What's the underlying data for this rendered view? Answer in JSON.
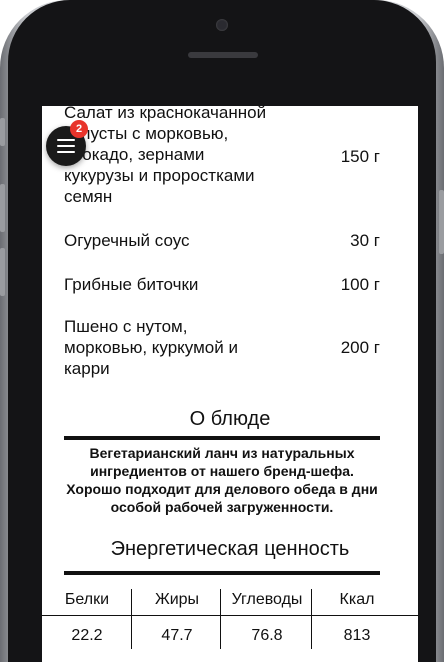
{
  "menu_items": [
    {
      "name": "Салат из краснокачанной капусты с морковью, авокадо, зернами кукурузы и проростками семян",
      "weight": "150 г"
    },
    {
      "name": "Огуречный соус",
      "weight": "30 г"
    },
    {
      "name": "Грибные биточки",
      "weight": "100 г"
    },
    {
      "name": "Пшено с нутом, морковью, куркумой и карри",
      "weight": "200 г"
    }
  ],
  "about": {
    "title": "О блюде",
    "text": "Вегетарианский ланч из натуральных ингредиентов от нашего бренд-шефа. Хорошо подходит для делового обеда в дни особой рабочей загруженности."
  },
  "nutrition": {
    "title": "Энергетическая ценность",
    "headers": [
      "Белки",
      "Жиры",
      "Углеводы",
      "Ккал"
    ],
    "values": [
      "22.2",
      "47.7",
      "76.8",
      "813"
    ]
  },
  "menu_button": {
    "badge_count": "2"
  },
  "colors": {
    "badge": "#e8342b",
    "menu_button": "#1a1a1a",
    "text": "#111111"
  }
}
